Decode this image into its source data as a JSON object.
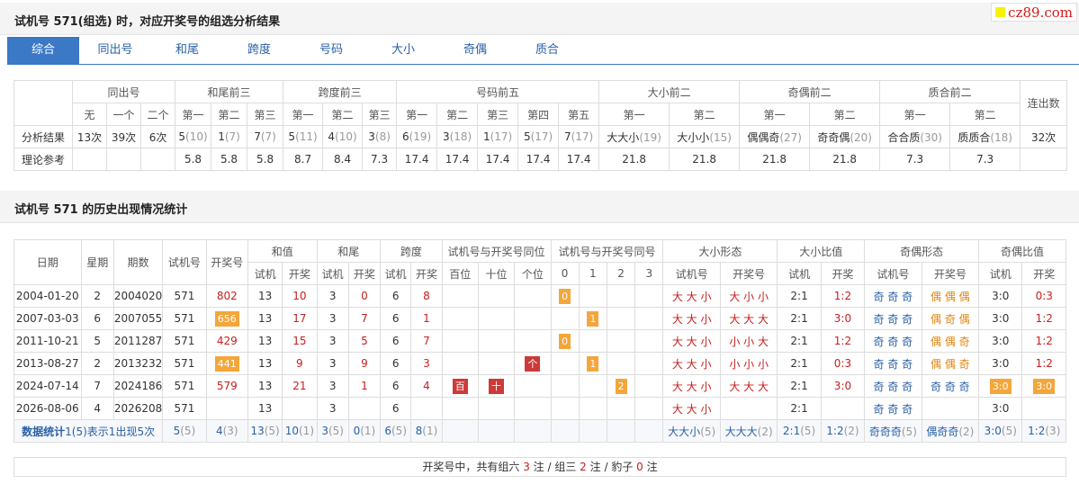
{
  "logo": "cz89.com",
  "section1": {
    "title": "试机号 571(组选) 时，对应开奖号的组选分析结果"
  },
  "tabs": [
    "综合",
    "同出号",
    "和尾",
    "跨度",
    "号码",
    "大小",
    "奇偶",
    "质合"
  ],
  "analysis": {
    "groups": [
      "同出号",
      "和尾前三",
      "跨度前三",
      "号码前五",
      "大小前二",
      "奇偶前二",
      "质合前二"
    ],
    "lianchu": "连出数",
    "sub": [
      "无",
      "一个",
      "二个",
      "第一",
      "第二",
      "第三",
      "第一",
      "第二",
      "第三",
      "第一",
      "第二",
      "第三",
      "第四",
      "第五",
      "第一",
      "第二",
      "第一",
      "第二",
      "第一",
      "第二"
    ],
    "row1_label": "分析结果",
    "row1": [
      [
        "13次",
        ""
      ],
      [
        "39次",
        ""
      ],
      [
        "6次",
        ""
      ],
      [
        "5",
        "(10)"
      ],
      [
        "1",
        "(7)"
      ],
      [
        "7",
        "(7)"
      ],
      [
        "5",
        "(11)"
      ],
      [
        "4",
        "(10)"
      ],
      [
        "3",
        "(8)"
      ],
      [
        "6",
        "(19)"
      ],
      [
        "3",
        "(18)"
      ],
      [
        "1",
        "(17)"
      ],
      [
        "5",
        "(17)"
      ],
      [
        "7",
        "(17)"
      ],
      [
        "大大小",
        "(19)"
      ],
      [
        "大小小",
        "(15)"
      ],
      [
        "偶偶奇",
        "(27)"
      ],
      [
        "奇奇偶",
        "(20)"
      ],
      [
        "合合质",
        "(30)"
      ],
      [
        "质质合",
        "(18)"
      ],
      [
        "32次",
        ""
      ]
    ],
    "row2_label": "理论参考",
    "row2": [
      "",
      "",
      "",
      "5.8",
      "5.8",
      "5.8",
      "8.7",
      "8.4",
      "7.3",
      "17.4",
      "17.4",
      "17.4",
      "17.4",
      "17.4",
      "21.8",
      "21.8",
      "21.8",
      "21.8",
      "7.3",
      "7.3",
      ""
    ]
  },
  "section2": {
    "title": "试机号 571 的历史出现情况统计"
  },
  "history": {
    "h": {
      "date": "日期",
      "week": "星期",
      "issue": "期数",
      "sj": "试机号",
      "kj": "开奖号",
      "hezhi": "和值",
      "hewei": "和尾",
      "kuadu": "跨度",
      "tongwei": "试机号与开奖号同位",
      "tonghao": "试机号与开奖号同号",
      "dxxt": "大小形态",
      "dxbz": "大小比值",
      "joxt": "奇偶形态",
      "jobz": "奇偶比值"
    },
    "sub": {
      "sj": "试机",
      "kj": "开奖",
      "bai": "百位",
      "shi": "十位",
      "ge": "个位",
      "n0": "0",
      "n1": "1",
      "n2": "2",
      "n3": "3",
      "sjh": "试机号",
      "kjh": "开奖号"
    },
    "rows": [
      {
        "date": "2004-01-20",
        "week": "2",
        "issue": "2004020",
        "sj": "571",
        "kj": "802",
        "kjHL": false,
        "hz_s": "13",
        "hz_k": "10",
        "hw_s": "3",
        "hw_k": "0",
        "kd_s": "6",
        "kd_k": "8",
        "bai": "",
        "shi": "",
        "ge": "",
        "n0": "0",
        "n1": "",
        "n2": "",
        "n3": "",
        "dx_s": "大 大 小",
        "dx_k": "大 小 小",
        "dxb_s": "2:1",
        "dxb_k": "1:2",
        "jo_s": "奇 奇 奇",
        "jo_k": "偶 偶 偶",
        "job_s": "3:0",
        "job_k": "0:3"
      },
      {
        "date": "2007-03-03",
        "week": "6",
        "issue": "2007055",
        "sj": "571",
        "kj": "656",
        "kjHL": true,
        "hz_s": "13",
        "hz_k": "17",
        "hw_s": "3",
        "hw_k": "7",
        "kd_s": "6",
        "kd_k": "1",
        "bai": "",
        "shi": "",
        "ge": "",
        "n0": "",
        "n1": "1",
        "n2": "",
        "n3": "",
        "dx_s": "大 大 小",
        "dx_k": "大 大 大",
        "dxb_s": "2:1",
        "dxb_k": "3:0",
        "jo_s": "奇 奇 奇",
        "jo_k": "偶 奇 偶",
        "job_s": "3:0",
        "job_k": "1:2"
      },
      {
        "date": "2011-10-21",
        "week": "5",
        "issue": "2011287",
        "sj": "571",
        "kj": "429",
        "kjHL": false,
        "hz_s": "13",
        "hz_k": "15",
        "hw_s": "3",
        "hw_k": "5",
        "kd_s": "6",
        "kd_k": "7",
        "bai": "",
        "shi": "",
        "ge": "",
        "n0": "0",
        "n1": "",
        "n2": "",
        "n3": "",
        "dx_s": "大 大 小",
        "dx_k": "小 小 大",
        "dxb_s": "2:1",
        "dxb_k": "1:2",
        "jo_s": "奇 奇 奇",
        "jo_k": "偶 偶 奇",
        "job_s": "3:0",
        "job_k": "1:2"
      },
      {
        "date": "2013-08-27",
        "week": "2",
        "issue": "2013232",
        "sj": "571",
        "kj": "441",
        "kjHL": true,
        "hz_s": "13",
        "hz_k": "9",
        "hw_s": "3",
        "hw_k": "9",
        "kd_s": "6",
        "kd_k": "3",
        "bai": "",
        "shi": "",
        "ge": "个",
        "n0": "",
        "n1": "1",
        "n2": "",
        "n3": "",
        "dx_s": "大 大 小",
        "dx_k": "小 小 小",
        "dxb_s": "2:1",
        "dxb_k": "0:3",
        "jo_s": "奇 奇 奇",
        "jo_k": "偶 偶 奇",
        "job_s": "3:0",
        "job_k": "1:2"
      },
      {
        "date": "2024-07-14",
        "week": "7",
        "issue": "2024186",
        "sj": "571",
        "kj": "579",
        "kjHL": false,
        "hz_s": "13",
        "hz_k": "21",
        "hw_s": "3",
        "hw_k": "1",
        "kd_s": "6",
        "kd_k": "4",
        "bai": "百",
        "shi": "十",
        "ge": "",
        "n0": "",
        "n1": "",
        "n2": "2",
        "n3": "",
        "dx_s": "大 大 小",
        "dx_k": "大 大 大",
        "dxb_s": "2:1",
        "dxb_k": "3:0",
        "jo_s": "奇 奇 奇",
        "jo_k": "奇 奇 奇",
        "job_s": "3:0",
        "job_k": "3:0",
        "jobHL": true
      },
      {
        "date": "2026-08-06",
        "week": "4",
        "issue": "2026208",
        "sj": "571",
        "kj": "",
        "kjHL": false,
        "hz_s": "13",
        "hz_k": "",
        "hw_s": "3",
        "hw_k": "",
        "kd_s": "6",
        "kd_k": "",
        "bai": "",
        "shi": "",
        "ge": "",
        "n0": "",
        "n1": "",
        "n2": "",
        "n3": "",
        "dx_s": "大 大 小",
        "dx_k": "",
        "dxb_s": "2:1",
        "dxb_k": "",
        "jo_s": "奇 奇 奇",
        "jo_k": "",
        "job_s": "3:0",
        "job_k": ""
      }
    ],
    "stats": {
      "label": "数据统计",
      "label_note": "1(5)表示1出现5次",
      "sj": [
        "5",
        "(5)"
      ],
      "kj": [
        "4",
        "(3)"
      ],
      "hz_s": [
        "13",
        "(5)"
      ],
      "hz_k": [
        "10",
        "(1)"
      ],
      "hw_s": [
        "3",
        "(5)"
      ],
      "hw_k": [
        "0",
        "(1)"
      ],
      "kd_s": [
        "6",
        "(5)"
      ],
      "kd_k": [
        "8",
        "(1)"
      ],
      "dx_s": [
        "大大小",
        "(5)"
      ],
      "dx_k": [
        "大大大",
        "(2)"
      ],
      "dxb_s": [
        "2:1",
        "(5)"
      ],
      "dxb_k": [
        "1:2",
        "(2)"
      ],
      "jo_s": [
        "奇奇奇",
        "(5)"
      ],
      "jo_k": [
        "偶奇奇",
        "(2)"
      ],
      "job_s": [
        "3:0",
        "(5)"
      ],
      "job_k": [
        "1:2",
        "(3)"
      ]
    }
  },
  "footer": {
    "pre": "开奖号中，共有组六",
    "zl": "3",
    "mid1": "注 / 组三",
    "zs": "2",
    "mid2": "注 / 豹子",
    "bz": "0",
    "post": "注"
  }
}
